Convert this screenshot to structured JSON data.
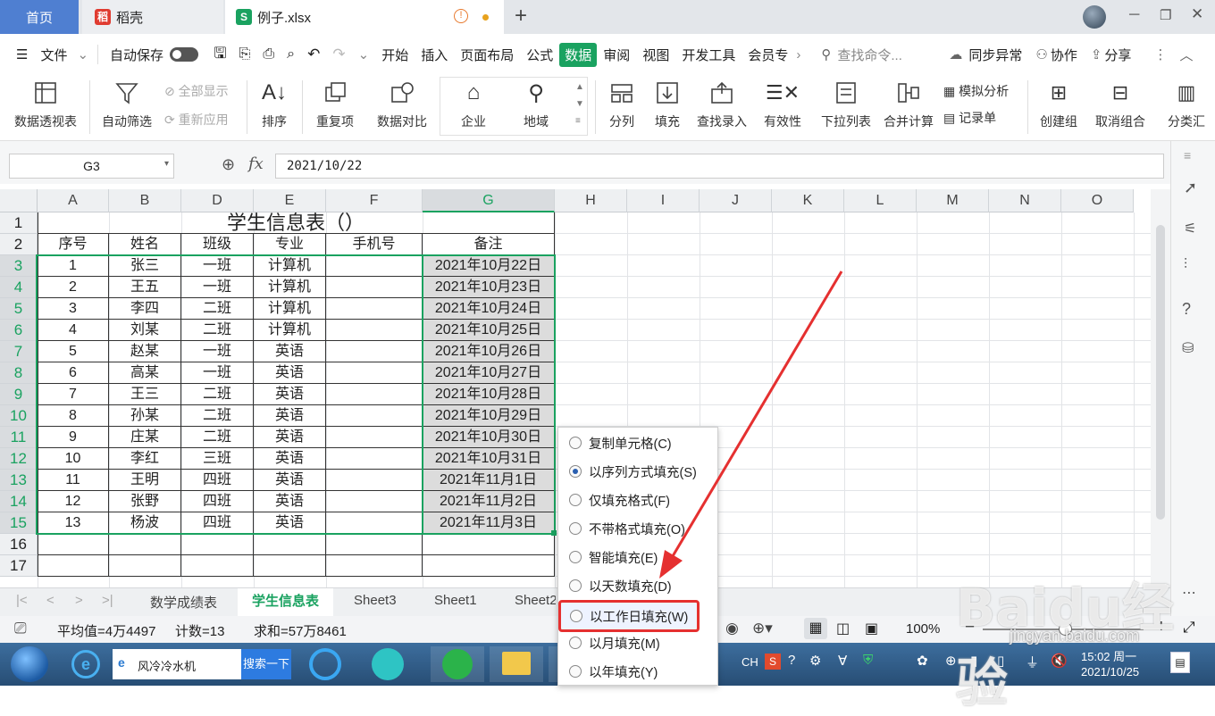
{
  "tabs": {
    "home": "首页",
    "daoke": "稻壳",
    "file": "例子.xlsx",
    "add": "+"
  },
  "menu": {
    "items": [
      "文件",
      "自动保存",
      "开始",
      "插入",
      "页面布局",
      "公式",
      "数据",
      "审阅",
      "视图",
      "开发工具",
      "会员专"
    ],
    "search": "查找命令...",
    "sync": "同步异常",
    "collab": "协作",
    "share": "分享"
  },
  "ribbon": {
    "pivot": "数据透视表",
    "autofilter": "自动筛选",
    "show_all": "全部显示",
    "reapply": "重新应用",
    "sort": "排序",
    "duplicates": "重复项",
    "compare": "数据对比",
    "enterprise": "企业",
    "region": "地域",
    "split": "分列",
    "fill": "填充",
    "lookup": "查找录入",
    "validity": "有效性",
    "dropdown": "下拉列表",
    "consolidate": "合并计算",
    "simulate": "模拟分析",
    "record": "记录单",
    "group": "创建组",
    "ungroup": "取消组合",
    "subtotal": "分类汇"
  },
  "formula": {
    "namebox": "G3",
    "fx": "fx",
    "value": "2021/10/22"
  },
  "columns": [
    "A",
    "B",
    "D",
    "E",
    "F",
    "G",
    "H",
    "I",
    "J",
    "K",
    "L",
    "M",
    "N",
    "O"
  ],
  "rows": [
    "1",
    "2",
    "3",
    "4",
    "5",
    "6",
    "7",
    "8",
    "9",
    "10",
    "11",
    "12",
    "13",
    "14",
    "15",
    "16",
    "17"
  ],
  "sheet": {
    "title": "学生信息表（）",
    "headers": [
      "序号",
      "姓名",
      "班级",
      "专业",
      "手机号",
      "备注"
    ],
    "data": [
      [
        "1",
        "张三",
        "一班",
        "计算机",
        "",
        "2021年10月22日"
      ],
      [
        "2",
        "王五",
        "一班",
        "计算机",
        "",
        "2021年10月23日"
      ],
      [
        "3",
        "李四",
        "二班",
        "计算机",
        "",
        "2021年10月24日"
      ],
      [
        "4",
        "刘某",
        "二班",
        "计算机",
        "",
        "2021年10月25日"
      ],
      [
        "5",
        "赵某",
        "一班",
        "英语",
        "",
        "2021年10月26日"
      ],
      [
        "6",
        "高某",
        "一班",
        "英语",
        "",
        "2021年10月27日"
      ],
      [
        "7",
        "王三",
        "二班",
        "英语",
        "",
        "2021年10月28日"
      ],
      [
        "8",
        "孙某",
        "二班",
        "英语",
        "",
        "2021年10月29日"
      ],
      [
        "9",
        "庄某",
        "二班",
        "英语",
        "",
        "2021年10月30日"
      ],
      [
        "10",
        "李红",
        "三班",
        "英语",
        "",
        "2021年10月31日"
      ],
      [
        "11",
        "王明",
        "四班",
        "英语",
        "",
        "2021年11月1日"
      ],
      [
        "12",
        "张野",
        "四班",
        "英语",
        "",
        "2021年11月2日"
      ],
      [
        "13",
        "杨波",
        "四班",
        "英语",
        "",
        "2021年11月3日"
      ]
    ]
  },
  "sheettabs": [
    "数学成绩表",
    "学生信息表",
    "Sheet3",
    "Sheet1",
    "Sheet2"
  ],
  "status": {
    "avg": "平均值=4万4497",
    "count": "计数=13",
    "sum": "求和=57万8461",
    "zoom": "100%"
  },
  "popup": {
    "options": [
      "复制单元格(C)",
      "以序列方式填充(S)",
      "仅填充格式(F)",
      "不带格式填充(O)",
      "智能填充(E)",
      "以天数填充(D)",
      "以工作日填充(W)",
      "以月填充(M)",
      "以年填充(Y)"
    ],
    "selected_index": 1,
    "highlight_index": 6
  },
  "taskbar": {
    "search_text": "风冷冷水机",
    "search_btn": "搜索一下",
    "ime": "CH",
    "time": "15:02 周一",
    "date": "2021/10/25"
  },
  "watermark": {
    "brand": "Baidu经验",
    "url": "jingyan.baidu.com"
  },
  "colors": {
    "accent": "#1aa260",
    "highlight": "#e53030",
    "home_tab": "#4f7fd1"
  }
}
